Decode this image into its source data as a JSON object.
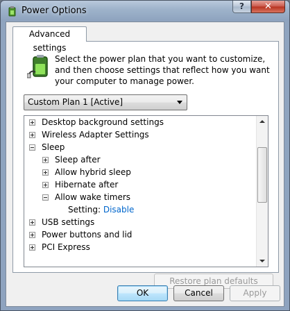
{
  "window": {
    "title": "Power Options",
    "help_label": "?",
    "close_label": "✕"
  },
  "tab": {
    "label": "Advanced settings"
  },
  "description": "Select the power plan that you want to customize, and then choose settings that reflect how you want your computer to manage power.",
  "plan_select": {
    "value": "Custom Plan 1 [Active]"
  },
  "tree": {
    "items": [
      {
        "label": "Desktop background settings",
        "expander": "plus"
      },
      {
        "label": "Wireless Adapter Settings",
        "expander": "plus"
      },
      {
        "label": "Sleep",
        "expander": "minus"
      },
      {
        "label": "Sleep after",
        "expander": "plus"
      },
      {
        "label": "Allow hybrid sleep",
        "expander": "plus"
      },
      {
        "label": "Hibernate after",
        "expander": "plus"
      },
      {
        "label": "Allow wake timers",
        "expander": "minus"
      },
      {
        "label": "Setting:",
        "value": "Disable"
      },
      {
        "label": "USB settings",
        "expander": "plus"
      },
      {
        "label": "Power buttons and lid",
        "expander": "plus"
      },
      {
        "label": "PCI Express",
        "expander": "plus"
      }
    ]
  },
  "buttons": {
    "restore": "Restore plan defaults",
    "ok": "OK",
    "cancel": "Cancel",
    "apply": "Apply"
  },
  "colors": {
    "link": "#0066cc",
    "disabled_text": "#9a9a9a"
  },
  "icons": [
    "power-options-icon",
    "battery-plug-icon",
    "help-icon",
    "close-icon",
    "dropdown-arrow-icon",
    "expand-icon",
    "collapse-icon",
    "scroll-up-icon",
    "scroll-down-icon"
  ]
}
